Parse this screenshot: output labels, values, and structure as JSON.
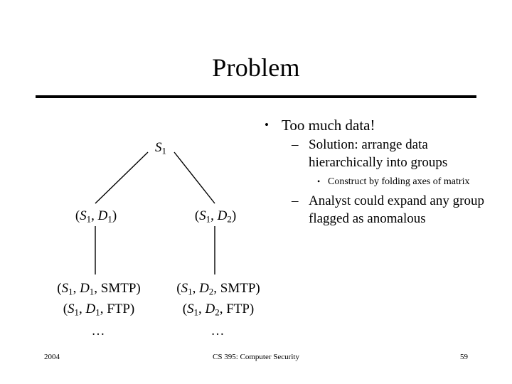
{
  "slide": {
    "title": "Problem",
    "accent_color": "#000000",
    "background_color": "#ffffff"
  },
  "tree": {
    "root": {
      "label": "S1",
      "base": "S",
      "sub": "1"
    },
    "level2": [
      {
        "label": "(S1, D1)",
        "prefix": "(",
        "v1": "S",
        "s1": "1",
        "mid": ", ",
        "v2": "D",
        "s2": "1",
        "suffix": ")"
      },
      {
        "label": "(S1, D2)",
        "prefix": "(",
        "v1": "S",
        "s1": "1",
        "mid": ", ",
        "v2": "D",
        "s2": "2",
        "suffix": ")"
      }
    ],
    "level3": [
      {
        "lines": [
          {
            "prefix": "(",
            "v1": "S",
            "s1": "1",
            "mid": ", ",
            "v2": "D",
            "s2": "1",
            "tail": ", SMTP)"
          },
          {
            "prefix": "(",
            "v1": "S",
            "s1": "1",
            "mid": ", ",
            "v2": "D",
            "s2": "1",
            "tail": ", FTP)"
          }
        ],
        "ellipsis": "…"
      },
      {
        "lines": [
          {
            "prefix": "(",
            "v1": "S",
            "s1": "1",
            "mid": ", ",
            "v2": "D",
            "s2": "2",
            "tail": ", SMTP)"
          },
          {
            "prefix": "(",
            "v1": "S",
            "s1": "1",
            "mid": ", ",
            "v2": "D",
            "s2": "2",
            "tail": ", FTP)"
          }
        ],
        "ellipsis": "…"
      }
    ]
  },
  "outline": {
    "items": [
      {
        "level": 1,
        "marker": "•",
        "text": "Too much data!"
      },
      {
        "level": 2,
        "marker": "–",
        "text": "Solution: arrange data hierarchically into groups"
      },
      {
        "level": 3,
        "marker": "•",
        "text": "Construct by folding axes of matrix"
      },
      {
        "level": 2,
        "marker": "–",
        "text": "Analyst could expand any group flagged as anomalous"
      }
    ]
  },
  "footer": {
    "date": "2004",
    "center": "CS 395: Computer Security",
    "page": "59"
  }
}
